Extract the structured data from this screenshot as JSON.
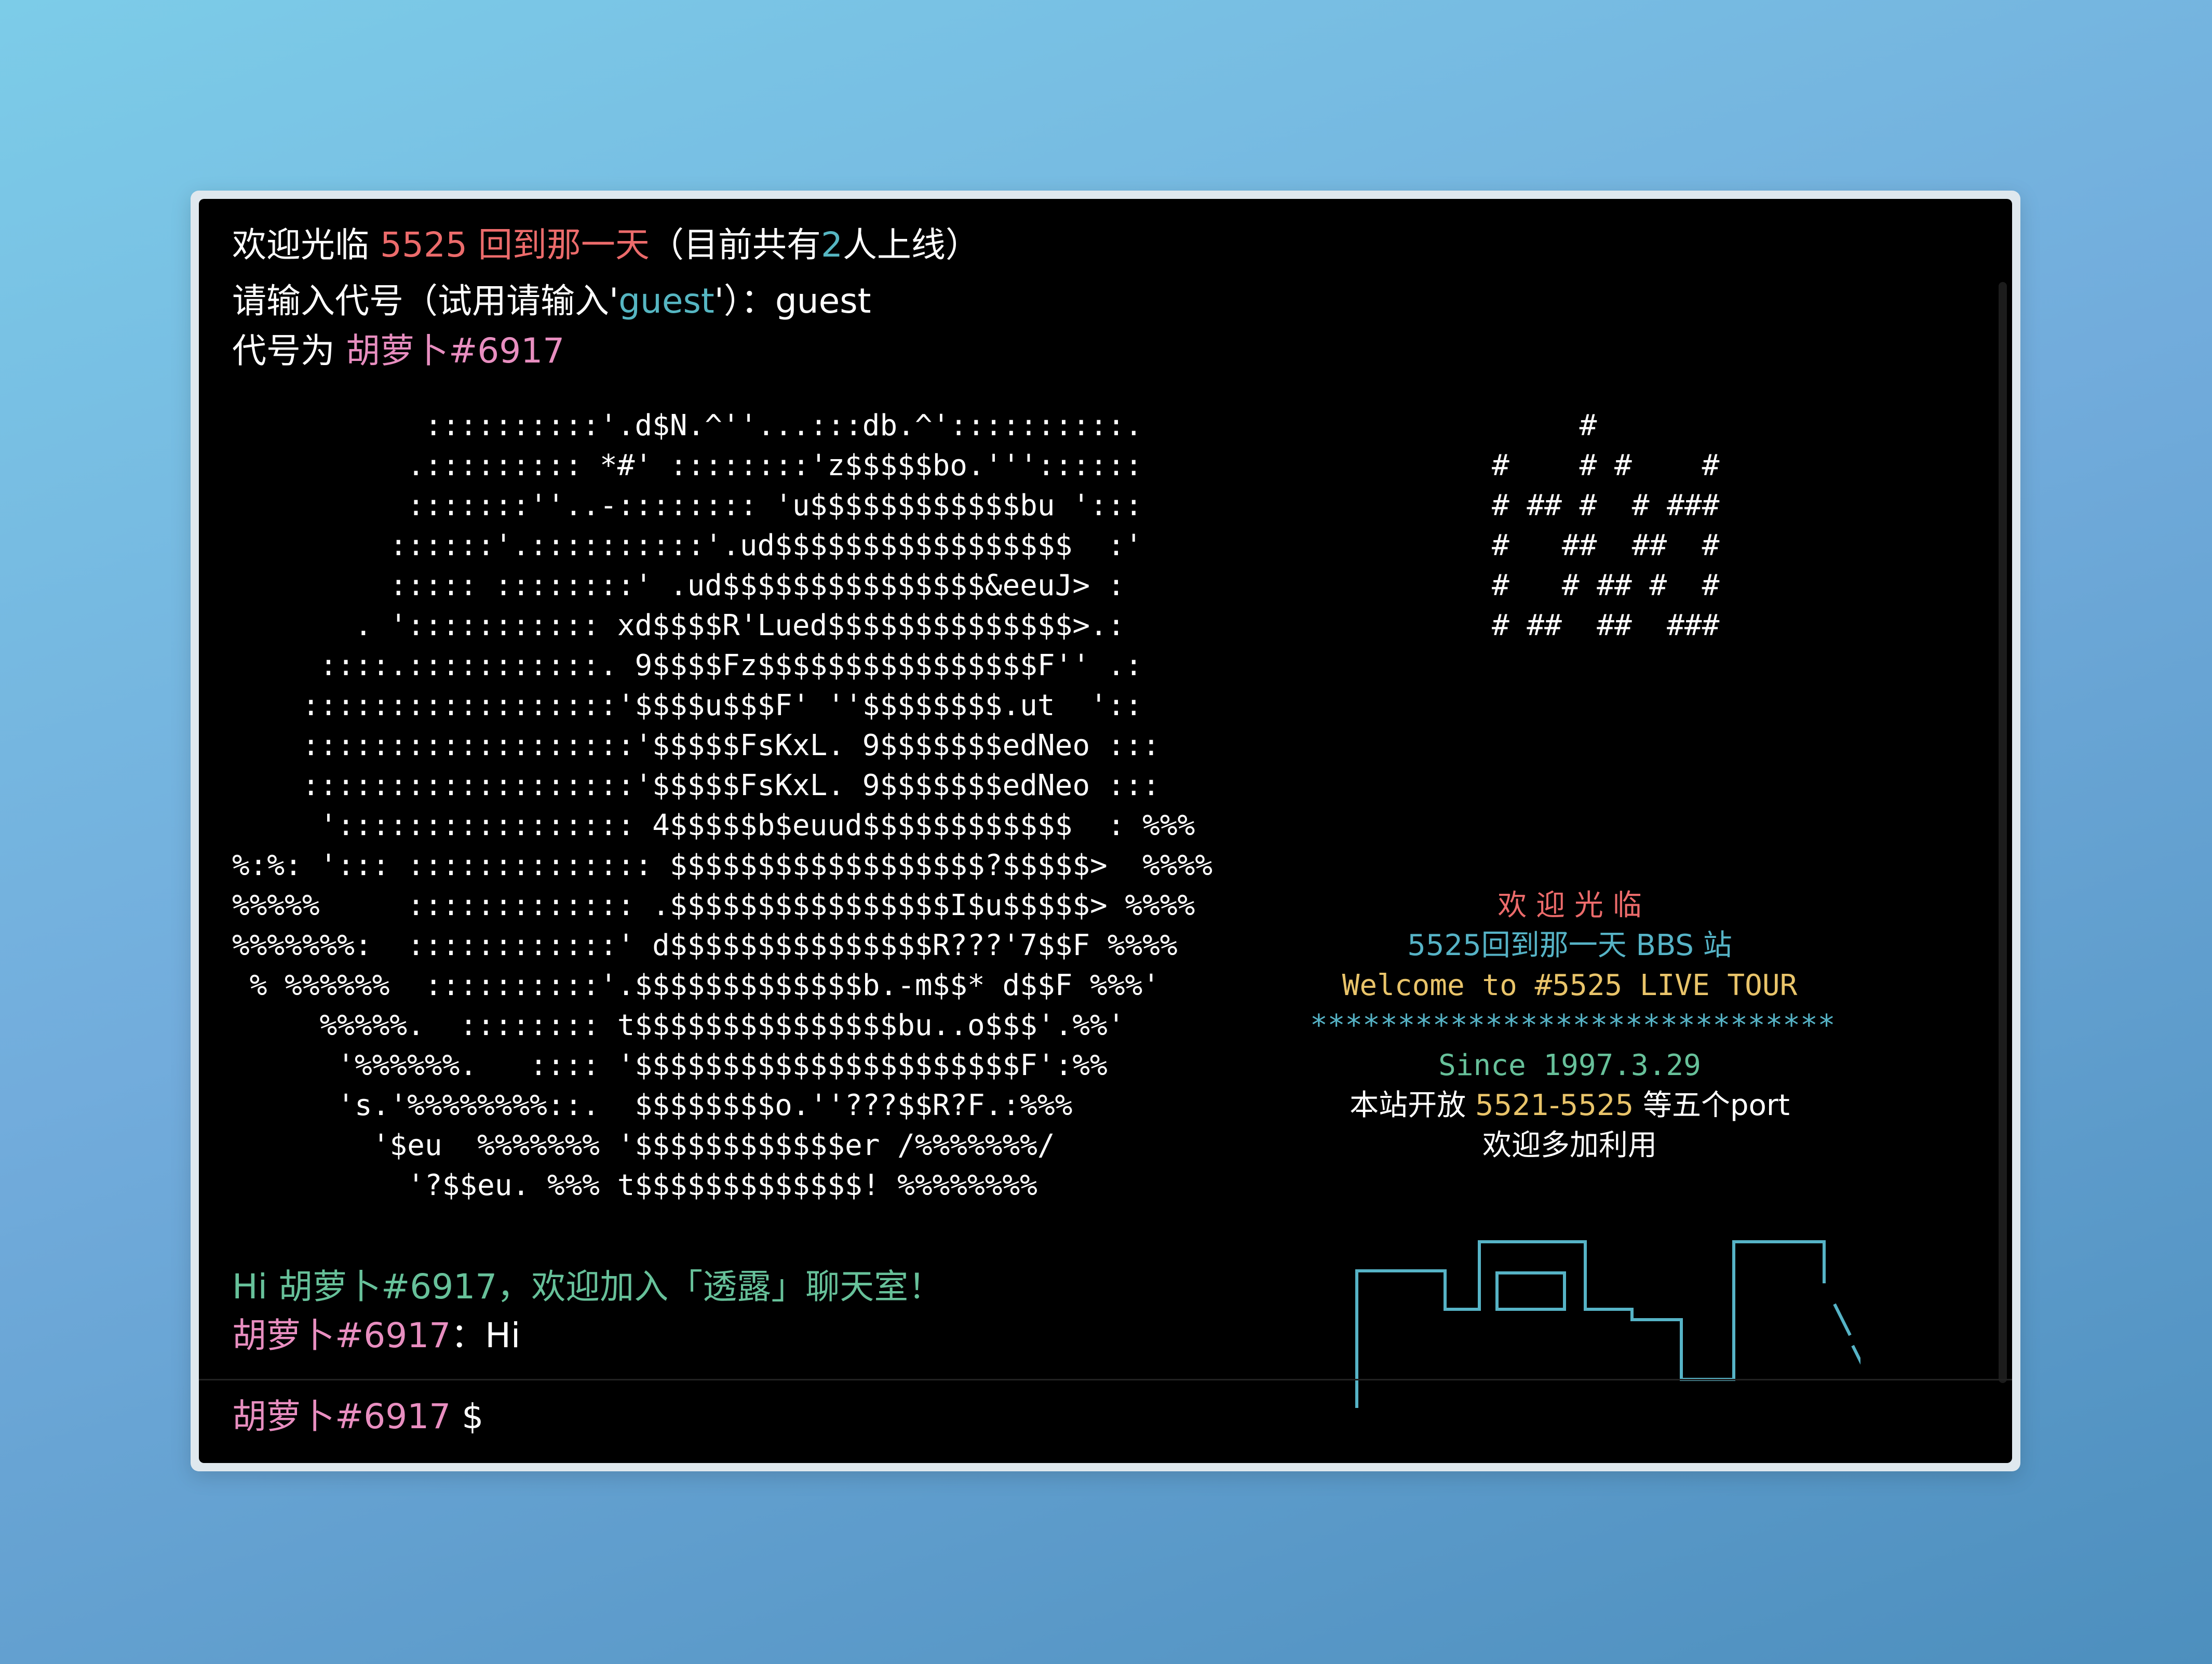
{
  "header": {
    "welcome_prefix": "欢迎光临 ",
    "site_name": "5525 回到那一天",
    "online_prefix": "（目前共有",
    "online_count": "2",
    "online_suffix": "人上线）"
  },
  "login": {
    "prompt_prefix": "请输入代号（试用请输入'",
    "guest_hint": "guest",
    "prompt_suffix": "'）：",
    "typed_value": "guest"
  },
  "assigned": {
    "label": "代号为 ",
    "name": "胡萝卜",
    "tag": "#6917"
  },
  "ascii_art_left": [
    "           ::::::::::'.d$N.^''...:::db.^'::::::::::.",
    "          .::::::::: *#' ::::::::'z$$$$$bo.''':::::: ",
    "          :::::::''..-:::::::: 'u$$$$$$$$$$$$bu ':::",
    "         ::::::'.::::::::::'.ud$$$$$$$$$$$$$$$$$  :'",
    "         ::::: ::::::::' .ud$$$$$$$$$$$$$$$&eeuJ> :",
    "       . '::::::::::: xd$$$$R'Lued$$$$$$$$$$$$$$>.:",
    "     ::::.:::::::::::. 9$$$$Fz$$$$$$$$$$$$$$$$F'' .:",
    "    ::::::::::::::::::'$$$$u$$$F' ''$$$$$$$$.ut  '::",
    "    :::::::::::::::::::'$$$$$FsKxL. 9$$$$$$$edNeo :::",
    "    :::::::::::::::::::'$$$$$FsKxL. 9$$$$$$$edNeo :::",
    "     '::::::::::::::::: 4$$$$$b$euud$$$$$$$$$$$$  : %%%",
    "%:%: '::: :::::::::::::: $$$$$$$$$$$$$$$$$$?$$$$$>  %%%%",
    "%%%%%     ::::::::::::: .$$$$$$$$$$$$$$$$I$u$$$$$> %%%%",
    "%%%%%%%:  ::::::::::::' d$$$$$$$$$$$$$$$R???'7$$F %%%%",
    " % %%%%%%  ::::::::::'.$$$$$$$$$$$$$b.-m$$* d$$F %%%'",
    "     %%%%%.  :::::::: t$$$$$$$$$$$$$$$bu..o$$$'.%%'",
    "      '%%%%%%.   :::: '$$$$$$$$$$$$$$$$$$$$$$F':%%",
    "      's.'%%%%%%%%::.  $$$$$$$$o.''???$$R?F.:%%%",
    "        '$eu  %%%%%%% '$$$$$$$$$$$$er /%%%%%%%/",
    "          '?$$eu. %%% t$$$$$$$$$$$$$! %%%%%%%%"
  ],
  "ascii_art_right": [
    "     #",
    "#    # #    #",
    "# ## #  # ###",
    "#   ##  ##  #",
    "#   # ## #  #",
    "# ##  ##  ###"
  ],
  "banner": {
    "welcome": "欢 迎 光 临",
    "bbs_name": "5525回到那一天 BBS 站",
    "tour": "Welcome to #5525 LIVE TOUR",
    "stars": "******************************",
    "since": "Since 1997.3.29",
    "ports_prefix": "本站开放 ",
    "ports_range": "5521-5525",
    "ports_suffix": " 等五个port",
    "invite": "欢迎多加利用"
  },
  "chat": {
    "join_message": "Hi 胡萝卜#6917，欢迎加入「透露」聊天室！",
    "msg_user": "胡萝卜",
    "msg_tag": "#6917",
    "msg_sep": "：",
    "msg_text": "Hi"
  },
  "prompt": {
    "user": "胡萝卜",
    "tag": "#6917",
    "symbol": " $"
  },
  "colors": {
    "background": "#000000",
    "red": "#ec6b6b",
    "teal": "#56b6c2",
    "pink": "#e88ec0",
    "green": "#67c19a",
    "yellow": "#e9c46a"
  }
}
